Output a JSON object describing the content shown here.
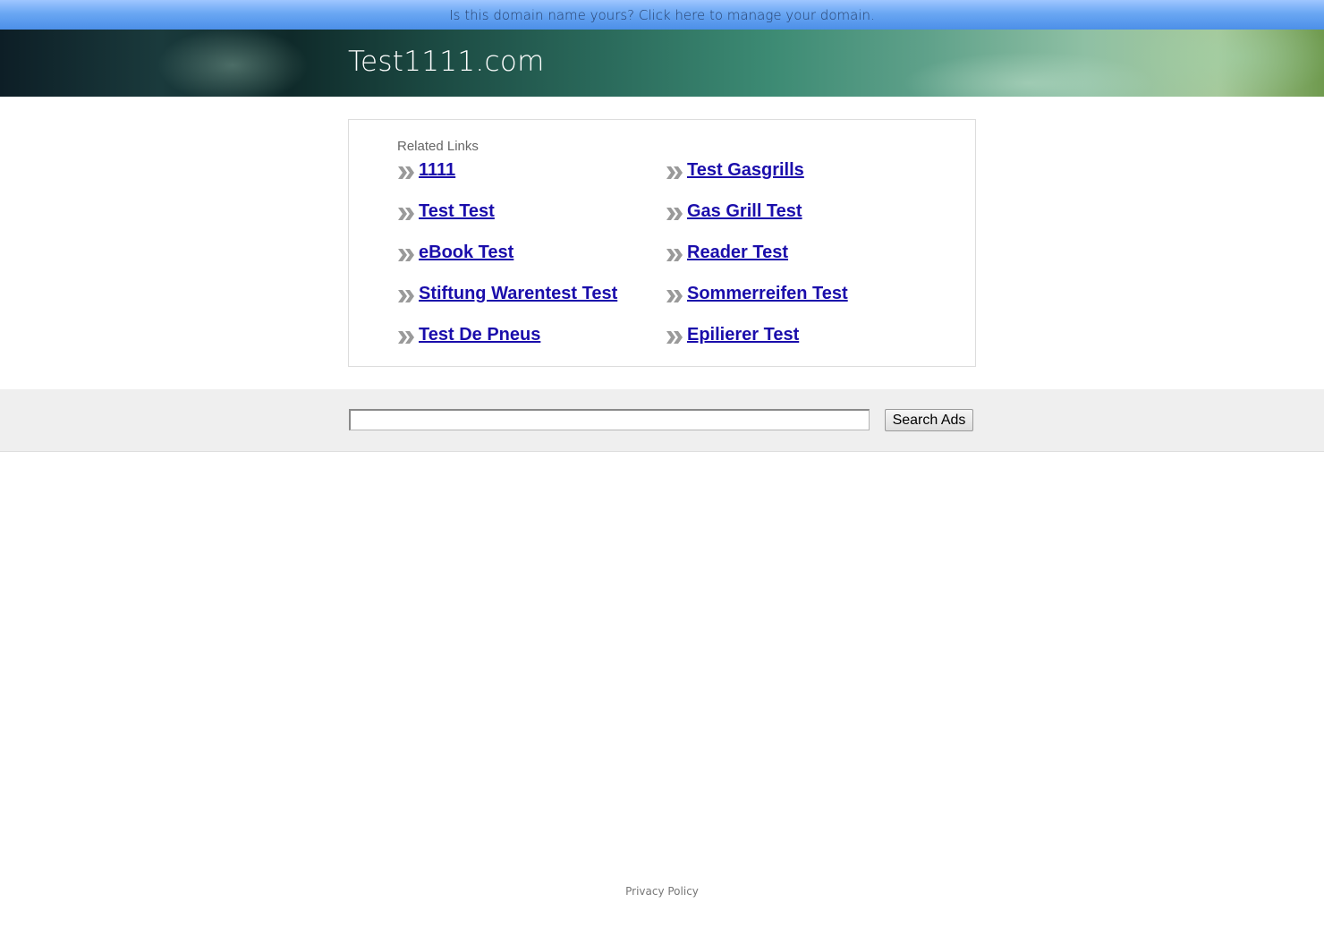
{
  "topbar": {
    "message": "Is this domain name yours? Click here to manage your domain."
  },
  "banner": {
    "title": "Test1111.com"
  },
  "related_links": {
    "heading": "Related Links",
    "left_column": [
      {
        "label": "1111"
      },
      {
        "label": "Test Test"
      },
      {
        "label": "eBook Test"
      },
      {
        "label": "Stiftung Warentest Test"
      },
      {
        "label": "Test De Pneus"
      }
    ],
    "right_column": [
      {
        "label": "Test Gasgrills"
      },
      {
        "label": "Gas Grill Test"
      },
      {
        "label": "Reader Test"
      },
      {
        "label": "Sommerreifen Test"
      },
      {
        "label": "Epilierer Test"
      }
    ],
    "link_color": "#1a0dab",
    "arrow_icon": "double-chevron-right-icon"
  },
  "search": {
    "input_value": "",
    "button_label": "Search Ads"
  },
  "footer": {
    "privacy_label": "Privacy Policy"
  }
}
